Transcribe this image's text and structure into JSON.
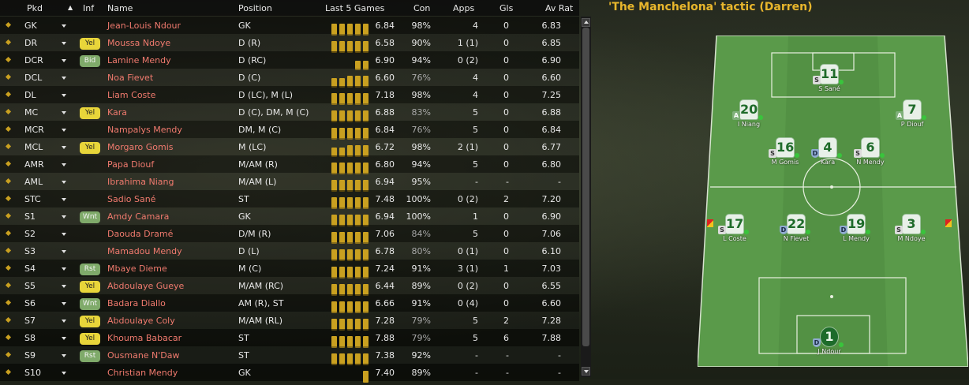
{
  "columns": {
    "pkd": "Pkd",
    "inf": "Inf",
    "name": "Name",
    "position": "Position",
    "last5": "Last 5 Games",
    "con": "Con",
    "apps": "Apps",
    "gls": "Gls",
    "avrat": "Av Rat"
  },
  "sort_indicator": "▲",
  "players": [
    {
      "pkd": "GK",
      "inf": "",
      "name": "Jean-Louis Ndour",
      "position": "GK",
      "last5": [
        5,
        5,
        5,
        5,
        5
      ],
      "rating": "6.84",
      "con": "98%",
      "apps": "4",
      "gls": "0",
      "avrat": "6.83"
    },
    {
      "pkd": "DR",
      "inf": "Yel",
      "name": "Moussa Ndoye",
      "position": "D (R)",
      "last5": [
        5,
        5,
        5,
        5,
        5
      ],
      "rating": "6.58",
      "con": "90%",
      "apps": "1 (1)",
      "gls": "0",
      "avrat": "6.85"
    },
    {
      "pkd": "DCR",
      "inf": "Bid",
      "name": "Lamine Mendy",
      "position": "D (RC)",
      "last5": [
        0,
        0,
        0,
        4,
        4
      ],
      "rating": "6.90",
      "con": "94%",
      "apps": "0 (2)",
      "gls": "0",
      "avrat": "6.90"
    },
    {
      "pkd": "DCL",
      "inf": "",
      "name": "Noa Fievet",
      "position": "D (C)",
      "last5": [
        4,
        4,
        5,
        5,
        5
      ],
      "rating": "6.60",
      "con": "76%",
      "apps": "4",
      "gls": "0",
      "avrat": "6.60"
    },
    {
      "pkd": "DL",
      "inf": "",
      "name": "Liam Coste",
      "position": "D (LC), M (L)",
      "last5": [
        5,
        5,
        5,
        5,
        5
      ],
      "rating": "7.18",
      "con": "98%",
      "apps": "4",
      "gls": "0",
      "avrat": "7.25"
    },
    {
      "pkd": "MC",
      "inf": "Yel",
      "name": "Kara",
      "position": "D (C), DM, M (C)",
      "last5": [
        5,
        5,
        5,
        5,
        5
      ],
      "rating": "6.88",
      "con": "83%",
      "apps": "5",
      "gls": "0",
      "avrat": "6.88"
    },
    {
      "pkd": "MCR",
      "inf": "",
      "name": "Nampalys Mendy",
      "position": "DM, M (C)",
      "last5": [
        5,
        5,
        5,
        5,
        5
      ],
      "rating": "6.84",
      "con": "76%",
      "apps": "5",
      "gls": "0",
      "avrat": "6.84"
    },
    {
      "pkd": "MCL",
      "inf": "Yel",
      "name": "Morgaro Gomis",
      "position": "M (LC)",
      "last5": [
        4,
        4,
        5,
        5,
        5
      ],
      "rating": "6.72",
      "con": "98%",
      "apps": "2 (1)",
      "gls": "0",
      "avrat": "6.77"
    },
    {
      "pkd": "AMR",
      "inf": "",
      "name": "Papa Diouf",
      "position": "M/AM (R)",
      "last5": [
        5,
        5,
        5,
        5,
        5
      ],
      "rating": "6.80",
      "con": "94%",
      "apps": "5",
      "gls": "0",
      "avrat": "6.80"
    },
    {
      "pkd": "AML",
      "inf": "",
      "name": "Ibrahima Niang",
      "position": "M/AM (L)",
      "last5": [
        5,
        5,
        5,
        5,
        5
      ],
      "rating": "6.94",
      "con": "95%",
      "apps": "-",
      "gls": "-",
      "avrat": "-"
    },
    {
      "pkd": "STC",
      "inf": "",
      "name": "Sadio Sané",
      "position": "ST",
      "last5": [
        5,
        5,
        5,
        5,
        5
      ],
      "rating": "7.48",
      "con": "100%",
      "apps": "0 (2)",
      "gls": "2",
      "avrat": "7.20"
    },
    {
      "pkd": "S1",
      "inf": "Wnt",
      "name": "Amdy Camara",
      "position": "GK",
      "last5": [
        5,
        5,
        5,
        5,
        5
      ],
      "rating": "6.94",
      "con": "100%",
      "apps": "1",
      "gls": "0",
      "avrat": "6.90"
    },
    {
      "pkd": "S2",
      "inf": "",
      "name": "Daouda Dramé",
      "position": "D/M (R)",
      "last5": [
        5,
        5,
        5,
        5,
        5
      ],
      "rating": "7.06",
      "con": "84%",
      "apps": "5",
      "gls": "0",
      "avrat": "7.06"
    },
    {
      "pkd": "S3",
      "inf": "",
      "name": "Mamadou Mendy",
      "position": "D (L)",
      "last5": [
        5,
        5,
        5,
        5,
        5
      ],
      "rating": "6.78",
      "con": "80%",
      "apps": "0 (1)",
      "gls": "0",
      "avrat": "6.10"
    },
    {
      "pkd": "S4",
      "inf": "Rst",
      "name": "Mbaye Dieme",
      "position": "M (C)",
      "last5": [
        5,
        5,
        5,
        5,
        5
      ],
      "rating": "7.24",
      "con": "91%",
      "apps": "3 (1)",
      "gls": "1",
      "avrat": "7.03"
    },
    {
      "pkd": "S5",
      "inf": "Yel",
      "name": "Abdoulaye Gueye",
      "position": "M/AM (RC)",
      "last5": [
        5,
        5,
        5,
        5,
        5
      ],
      "rating": "6.44",
      "con": "89%",
      "apps": "0 (2)",
      "gls": "0",
      "avrat": "6.55"
    },
    {
      "pkd": "S6",
      "inf": "Wnt",
      "name": "Badara Diallo",
      "position": "AM (R), ST",
      "last5": [
        5,
        5,
        5,
        5,
        5
      ],
      "rating": "6.66",
      "con": "91%",
      "apps": "0 (4)",
      "gls": "0",
      "avrat": "6.60"
    },
    {
      "pkd": "S7",
      "inf": "Yel",
      "name": "Abdoulaye Coly",
      "position": "M/AM (RL)",
      "last5": [
        5,
        5,
        5,
        5,
        5
      ],
      "rating": "7.28",
      "con": "79%",
      "apps": "5",
      "gls": "2",
      "avrat": "7.28"
    },
    {
      "pkd": "S8",
      "inf": "Yel",
      "name": "Khouma Babacar",
      "position": "ST",
      "last5": [
        5,
        5,
        5,
        5,
        5
      ],
      "rating": "7.88",
      "con": "79%",
      "apps": "5",
      "gls": "6",
      "avrat": "7.88"
    },
    {
      "pkd": "S9",
      "inf": "Rst",
      "name": "Ousmane N'Daw",
      "position": "ST",
      "last5": [
        5,
        5,
        5,
        5,
        5
      ],
      "rating": "7.38",
      "con": "92%",
      "apps": "-",
      "gls": "-",
      "avrat": "-"
    },
    {
      "pkd": "S10",
      "inf": "",
      "name": "Christian Mendy",
      "position": "GK",
      "last5": [
        0,
        0,
        0,
        0,
        5
      ],
      "rating": "7.40",
      "con": "89%",
      "apps": "-",
      "gls": "-",
      "avrat": "-"
    }
  ],
  "tactic_title": "'The Manchelona' tactic (Darren)",
  "pitch_players": [
    {
      "number": "11",
      "label": "S Sané",
      "role": "S"
    },
    {
      "number": "20",
      "label": "I Niang",
      "role": "A"
    },
    {
      "number": "7",
      "label": "P Diouf",
      "role": "A"
    },
    {
      "number": "16",
      "label": "M Gomis",
      "role": "S"
    },
    {
      "number": "4",
      "label": "Kara",
      "role": "D"
    },
    {
      "number": "6",
      "label": "N Mendy",
      "role": "S"
    },
    {
      "number": "17",
      "label": "L Coste",
      "role": "S"
    },
    {
      "number": "22",
      "label": "N Fievet",
      "role": "D"
    },
    {
      "number": "19",
      "label": "L Mendy",
      "role": "D"
    },
    {
      "number": "3",
      "label": "M Ndoye",
      "role": "S"
    },
    {
      "number": "1",
      "label": "J Ndour",
      "role": "D"
    }
  ],
  "colors": {
    "accent": "#e8b62c",
    "name": "#f07a6e",
    "bar": "#c9a020",
    "yel_badge": "#e8d53a",
    "green_badge": "#7faa6a",
    "pitch": "#5a9a4a"
  },
  "icons": {
    "pkd_marker": "diamond-icon",
    "dropdown": "chevron-down-icon",
    "scroll_up": "arrow-up-icon",
    "scroll_down": "arrow-down-icon",
    "fitness": "green-dot-icon",
    "captain_flag": "flag-icon"
  }
}
